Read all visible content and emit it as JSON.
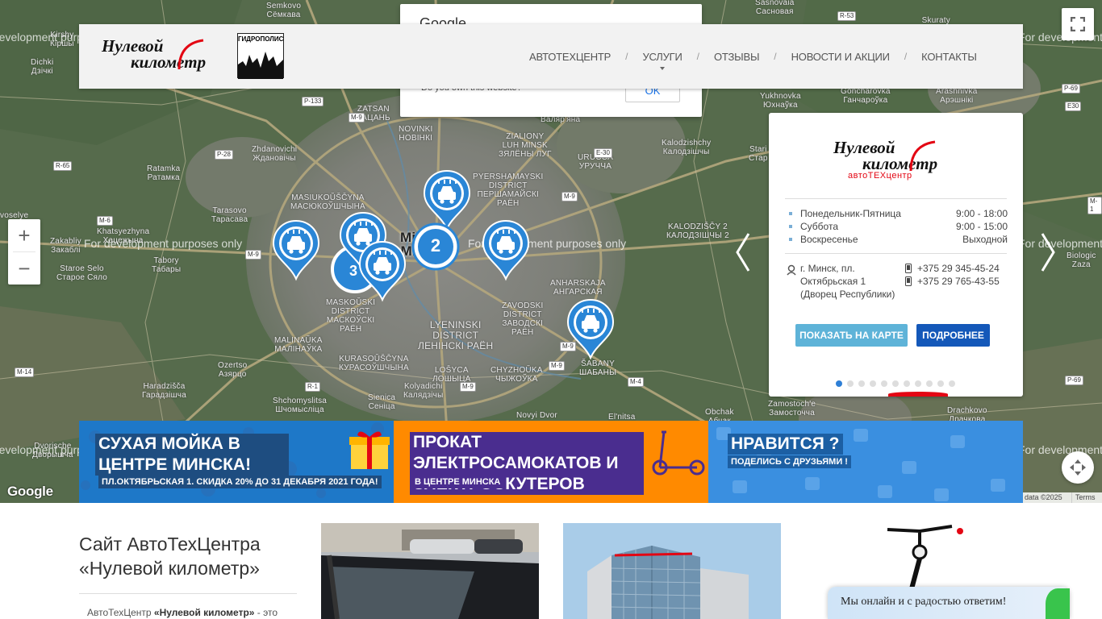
{
  "map": {
    "dev_watermark": "For development purposes only",
    "zoom_in": "+",
    "zoom_out": "−",
    "google_logo": "Google",
    "attribution": "data ©2025",
    "terms": "Terms",
    "places": {
      "semkovo": "Semkovo\nСёмкава",
      "kirshy": "Kirshy\nКіршы",
      "dichki": "Dichki\nДзічкі",
      "zatsan": "ZATSAN\nЗАЦАНЬ",
      "novinki": "NOVINKI\nНОВІНКІ",
      "zialiony": "ZIALIONY\nLUH MINSK\nЗЯЛЁНЫ ЛУГ",
      "valiar": "Валяр'яна",
      "zhdanovichi": "Zhdanovichi\nЖдановічы",
      "ratamka": "Ratamka\nРатамка",
      "masiukoushchyna": "MASIUKOŬŠČYNA\nМАСЮКОЎШЧЫНА",
      "tarasovo": "Tarasovo\nТарасава",
      "khatsyezhyna": "Khatsyezhyna\nХацежына",
      "zakabliy": "Zakabliy\nЗакаблі",
      "tabory": "Tabory\nТабары",
      "staroe_selo": "Staroe Selo\nСтарое Сяло",
      "maskouski": "MASKOŬSKI\nDISTRICT\nМАСКОЎСКІ\nРАЁН",
      "malinauka": "MALINAŬKA\nМАЛІНАЎКА",
      "kurasouschyna": "KURASOŬŠČYNA\nКУРАСОЎШЧЫНА",
      "ozertso": "Ozertso\nАзярцо",
      "haradzishcha": "Haradzišča\nГарадзішча",
      "shchomyslitsa": "Shchomyslitsa\nШчомысліца",
      "sienica": "Sienica\nСеніца",
      "kolyadichi": "Kolyadichi\nКалядзічы",
      "novyi_dvor": "Novyi Dvor",
      "dvorische": "Dvorische\nДворышча",
      "lyeninski": "LYENINSKI\nDISTRICT\nЛЕНІНСКІ РАЁН",
      "loshytsa": "LOŠYCA\nЛОШЫЦА",
      "chyzhouka": "CHYZHOŬKA\nЧЫЖОЎКА",
      "zavodski": "ZAVODSKI\nDISTRICT\nЗАВОДСКІ\nРАЁН",
      "anharskaja": "ANHARSKAJA\nАНГАРСКАЯ",
      "shabany": "ŠABANY\nШАБАНЫ",
      "pershamaiski": "PYERSHAMAYSKI\nDISTRICT\nПЕРШАМАЙСКІ\nРАЁН",
      "uruchcha": "URUCCA\nУРУЧЧА",
      "sasnovaia": "Sasnovaia\nСасновая",
      "skuraty": "Skuraty\nСкураты",
      "kalodzishchy": "Kalodzishchy\nКалодзішчы",
      "kalodzishchy2": "KALODZIŠČY 2\nКАЛОДЗІШЧЫ 2",
      "yukhnovka": "Yukhnovka\nЮхнаўка",
      "goncharovka": "Goncharovka\nГанчароўка",
      "arashnivka": "Arashnivka\nАрэшнікі",
      "zamostoche": "Zamostoch'e\nЗамосточча",
      "obchak": "Obchak\nАбчак",
      "elnitsa": "El'nitsa",
      "drachkovo": "Drachkovo\nДрачкова",
      "minsk": "Minsk\nМінск",
      "voselye": "voselye",
      "biologic": "Biologic\nZaza",
      "kletsovichi": "Khatsyezhyna",
      "staryi": "Stari\nСтар"
    },
    "cluster_count": "2",
    "cluster_count2": "3"
  },
  "google_dialog": {
    "title": "Google",
    "question": "Do you own this website?",
    "ok": "OK"
  },
  "header": {
    "logo_line1": "Нулевой",
    "logo_line2": "километр",
    "partner_logo": "ГИДРОПОЛИС",
    "nav": [
      {
        "label": "АВТОТЕХЦЕНТР"
      },
      {
        "label": "УСЛУГИ"
      },
      {
        "label": "ОТЗЫВЫ"
      },
      {
        "label": "НОВОСТИ И АКЦИИ"
      },
      {
        "label": "КОНТАКТЫ"
      }
    ],
    "separator": "/"
  },
  "card": {
    "logo_line1": "Нулевой",
    "logo_line2": "километр",
    "logo_sub": "автоТЕХцентр",
    "hours": [
      {
        "day": "Понедельник-Пятница",
        "time": "9:00 - 18:00"
      },
      {
        "day": "Суббота",
        "time": "9:00 - 15:00"
      },
      {
        "day": "Воскресенье",
        "time": "Выходной"
      }
    ],
    "address": "г. Минск, пл. Октябрьская 1 (Дворец Республики)",
    "phones": [
      "+375 29 345-45-24",
      "+375 29 765-43-55"
    ],
    "btn_map": "ПОКАЗАТЬ НА КАРТЕ",
    "btn_more": "ПОДРОБНЕЕ",
    "active_slide": 1,
    "slide_count": 11,
    "colors": {
      "btn_map": "#5eb3d8",
      "btn_more": "#1458b9",
      "accent": "#e30613"
    }
  },
  "banners": [
    {
      "title": "СУХАЯ МОЙКА В ЦЕНТРЕ МИНСКА!",
      "subtitle": "ПЛ.ОКТЯБРЬСКАЯ 1. СКИДКА 20% ДО 31 ДЕКАБРЯ 2021 ГОДА!",
      "color": "#1e78c8"
    },
    {
      "title": "ПРОКАТ ЭЛЕКТРОСАМОКАТОВ И ЭЛЕКТРОСКУТЕРОВ",
      "subtitle": "В ЦЕНТРЕ МИНСКА",
      "color": "#ff8a00"
    },
    {
      "title": "НРАВИТСЯ ?",
      "subtitle": "ПОДЕЛИСЬ С ДРУЗЬЯМИ !",
      "color": "#3a8fe0"
    }
  ],
  "site": {
    "title": "Сайт АвтоТехЦентра «Нулевой километр»",
    "intro_prefix": "АвтоТехЦентр ",
    "intro_bold": "«Нулевой километр»",
    "intro_suffix": " - это"
  },
  "chat": {
    "text": "Мы онлайн и с радостью ответим!"
  }
}
